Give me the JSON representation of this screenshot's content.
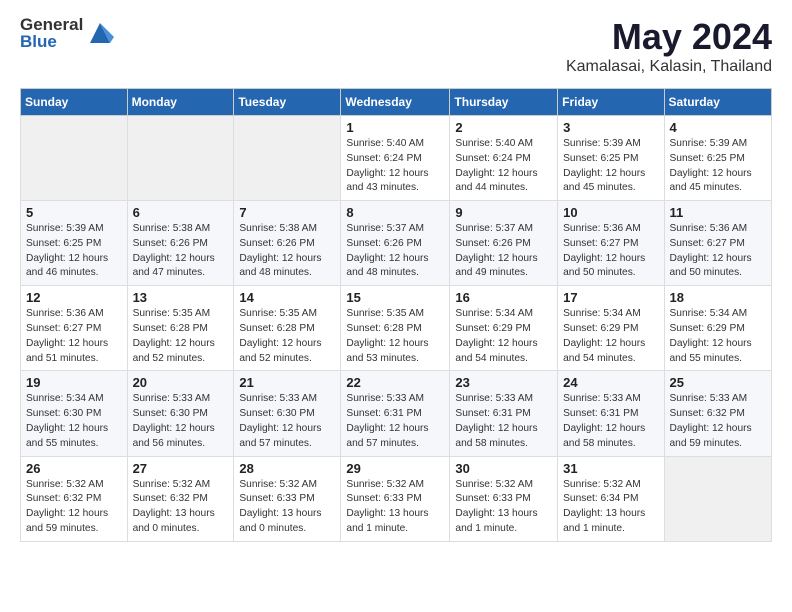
{
  "header": {
    "logo_general": "General",
    "logo_blue": "Blue",
    "month": "May 2024",
    "location": "Kamalasai, Kalasin, Thailand"
  },
  "weekdays": [
    "Sunday",
    "Monday",
    "Tuesday",
    "Wednesday",
    "Thursday",
    "Friday",
    "Saturday"
  ],
  "weeks": [
    [
      {
        "day": "",
        "info": ""
      },
      {
        "day": "",
        "info": ""
      },
      {
        "day": "",
        "info": ""
      },
      {
        "day": "1",
        "info": "Sunrise: 5:40 AM\nSunset: 6:24 PM\nDaylight: 12 hours\nand 43 minutes."
      },
      {
        "day": "2",
        "info": "Sunrise: 5:40 AM\nSunset: 6:24 PM\nDaylight: 12 hours\nand 44 minutes."
      },
      {
        "day": "3",
        "info": "Sunrise: 5:39 AM\nSunset: 6:25 PM\nDaylight: 12 hours\nand 45 minutes."
      },
      {
        "day": "4",
        "info": "Sunrise: 5:39 AM\nSunset: 6:25 PM\nDaylight: 12 hours\nand 45 minutes."
      }
    ],
    [
      {
        "day": "5",
        "info": "Sunrise: 5:39 AM\nSunset: 6:25 PM\nDaylight: 12 hours\nand 46 minutes."
      },
      {
        "day": "6",
        "info": "Sunrise: 5:38 AM\nSunset: 6:26 PM\nDaylight: 12 hours\nand 47 minutes."
      },
      {
        "day": "7",
        "info": "Sunrise: 5:38 AM\nSunset: 6:26 PM\nDaylight: 12 hours\nand 48 minutes."
      },
      {
        "day": "8",
        "info": "Sunrise: 5:37 AM\nSunset: 6:26 PM\nDaylight: 12 hours\nand 48 minutes."
      },
      {
        "day": "9",
        "info": "Sunrise: 5:37 AM\nSunset: 6:26 PM\nDaylight: 12 hours\nand 49 minutes."
      },
      {
        "day": "10",
        "info": "Sunrise: 5:36 AM\nSunset: 6:27 PM\nDaylight: 12 hours\nand 50 minutes."
      },
      {
        "day": "11",
        "info": "Sunrise: 5:36 AM\nSunset: 6:27 PM\nDaylight: 12 hours\nand 50 minutes."
      }
    ],
    [
      {
        "day": "12",
        "info": "Sunrise: 5:36 AM\nSunset: 6:27 PM\nDaylight: 12 hours\nand 51 minutes."
      },
      {
        "day": "13",
        "info": "Sunrise: 5:35 AM\nSunset: 6:28 PM\nDaylight: 12 hours\nand 52 minutes."
      },
      {
        "day": "14",
        "info": "Sunrise: 5:35 AM\nSunset: 6:28 PM\nDaylight: 12 hours\nand 52 minutes."
      },
      {
        "day": "15",
        "info": "Sunrise: 5:35 AM\nSunset: 6:28 PM\nDaylight: 12 hours\nand 53 minutes."
      },
      {
        "day": "16",
        "info": "Sunrise: 5:34 AM\nSunset: 6:29 PM\nDaylight: 12 hours\nand 54 minutes."
      },
      {
        "day": "17",
        "info": "Sunrise: 5:34 AM\nSunset: 6:29 PM\nDaylight: 12 hours\nand 54 minutes."
      },
      {
        "day": "18",
        "info": "Sunrise: 5:34 AM\nSunset: 6:29 PM\nDaylight: 12 hours\nand 55 minutes."
      }
    ],
    [
      {
        "day": "19",
        "info": "Sunrise: 5:34 AM\nSunset: 6:30 PM\nDaylight: 12 hours\nand 55 minutes."
      },
      {
        "day": "20",
        "info": "Sunrise: 5:33 AM\nSunset: 6:30 PM\nDaylight: 12 hours\nand 56 minutes."
      },
      {
        "day": "21",
        "info": "Sunrise: 5:33 AM\nSunset: 6:30 PM\nDaylight: 12 hours\nand 57 minutes."
      },
      {
        "day": "22",
        "info": "Sunrise: 5:33 AM\nSunset: 6:31 PM\nDaylight: 12 hours\nand 57 minutes."
      },
      {
        "day": "23",
        "info": "Sunrise: 5:33 AM\nSunset: 6:31 PM\nDaylight: 12 hours\nand 58 minutes."
      },
      {
        "day": "24",
        "info": "Sunrise: 5:33 AM\nSunset: 6:31 PM\nDaylight: 12 hours\nand 58 minutes."
      },
      {
        "day": "25",
        "info": "Sunrise: 5:33 AM\nSunset: 6:32 PM\nDaylight: 12 hours\nand 59 minutes."
      }
    ],
    [
      {
        "day": "26",
        "info": "Sunrise: 5:32 AM\nSunset: 6:32 PM\nDaylight: 12 hours\nand 59 minutes."
      },
      {
        "day": "27",
        "info": "Sunrise: 5:32 AM\nSunset: 6:32 PM\nDaylight: 13 hours\nand 0 minutes."
      },
      {
        "day": "28",
        "info": "Sunrise: 5:32 AM\nSunset: 6:33 PM\nDaylight: 13 hours\nand 0 minutes."
      },
      {
        "day": "29",
        "info": "Sunrise: 5:32 AM\nSunset: 6:33 PM\nDaylight: 13 hours\nand 1 minute."
      },
      {
        "day": "30",
        "info": "Sunrise: 5:32 AM\nSunset: 6:33 PM\nDaylight: 13 hours\nand 1 minute."
      },
      {
        "day": "31",
        "info": "Sunrise: 5:32 AM\nSunset: 6:34 PM\nDaylight: 13 hours\nand 1 minute."
      },
      {
        "day": "",
        "info": ""
      }
    ]
  ]
}
